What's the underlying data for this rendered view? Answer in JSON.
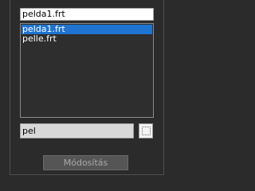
{
  "name_field": {
    "value": "pelda1.frt"
  },
  "file_list": {
    "items": [
      {
        "label": "pelda1.frt",
        "selected": true
      },
      {
        "label": "pelle.frt",
        "selected": false
      }
    ],
    "selected_color": "#1e74d0"
  },
  "filter_field": {
    "value": "pel"
  },
  "apply_button": {
    "label": "Módosítás",
    "enabled": false
  }
}
